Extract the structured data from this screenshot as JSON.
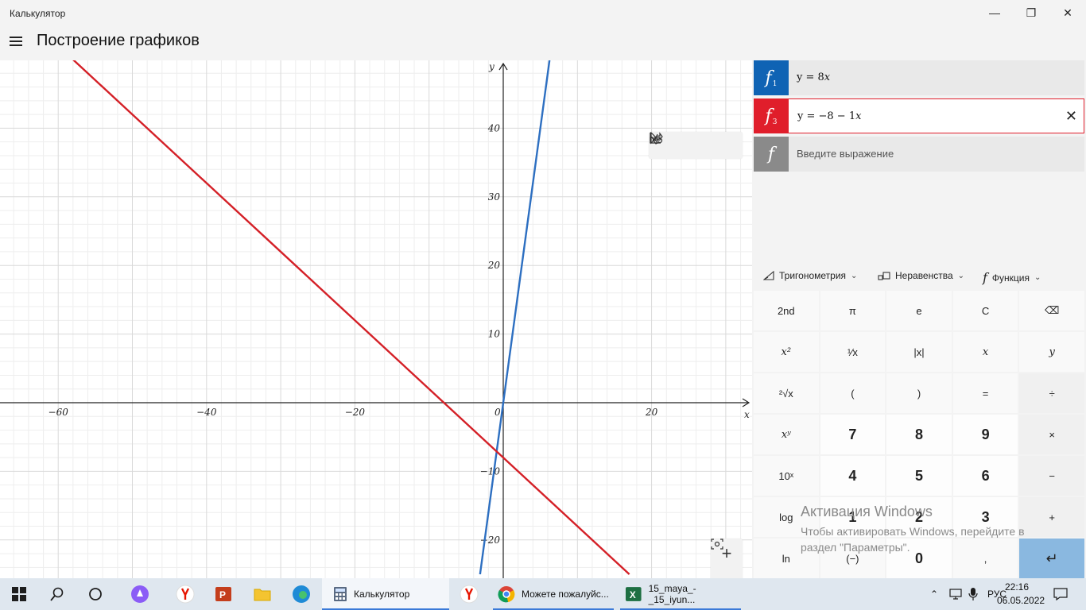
{
  "window": {
    "title": "Калькулятор"
  },
  "header": {
    "title": "Построение графиков"
  },
  "graph": {
    "x_ticks": [
      "−60",
      "−40",
      "−20",
      "0",
      "20"
    ],
    "y_ticks": [
      "40",
      "30",
      "20",
      "10",
      "−10",
      "−20"
    ],
    "x_axis_label": "x",
    "y_axis_label": "y",
    "colors": {
      "f1": "#2d6fc1",
      "f3": "#d42027",
      "grid": "#d9d9d9",
      "axis": "#222222"
    }
  },
  "chart_data": {
    "type": "line",
    "title": "",
    "xlabel": "x",
    "ylabel": "y",
    "xlim": [
      -68,
      33
    ],
    "ylim": [
      -25,
      50
    ],
    "grid": true,
    "series": [
      {
        "name": "y = 8x",
        "x": [
          -3.125,
          6.25
        ],
        "y": [
          -25,
          50
        ],
        "color": "#2d6fc1"
      },
      {
        "name": "y = −8 − 1x",
        "x": [
          -58,
          17
        ],
        "y": [
          50,
          -25
        ],
        "color": "#d42027"
      }
    ]
  },
  "functions": [
    {
      "badge": "f",
      "sub": "1",
      "prefix": "y = 8",
      "var": "x",
      "color": "#0f63b4"
    },
    {
      "badge": "f",
      "sub": "3",
      "prefix": "y = −8 − 1",
      "var": "x",
      "color": "#e01e2b"
    }
  ],
  "new_function": {
    "badge": "f",
    "placeholder": "Введите выражение",
    "color": "#8a8a8a"
  },
  "menus": {
    "trig": "Тригонометрия",
    "ineq": "Неравенства",
    "func": "Функция"
  },
  "keys": [
    [
      "2nd",
      "π",
      "e",
      "C",
      "⌫"
    ],
    [
      "x²",
      "¹⁄x",
      "|x|",
      "x",
      "y"
    ],
    [
      "²√x",
      "(",
      ")",
      "=",
      "÷"
    ],
    [
      "xʸ",
      "7",
      "8",
      "9",
      "×"
    ],
    [
      "10ˣ",
      "4",
      "5",
      "6",
      "−"
    ],
    [
      "log",
      "1",
      "2",
      "3",
      "+"
    ],
    [
      "ln",
      "(−)",
      "0",
      ",",
      "↵"
    ]
  ],
  "watermark": {
    "title": "Активация Windows",
    "text": "Чтобы активировать Windows, перейдите в раздел \"Параметры\"."
  },
  "taskbar": {
    "apps": [
      {
        "label": "Калькулятор"
      },
      {
        "label": "Можете пожалуйс..."
      },
      {
        "label": "15_maya_-_15_iyun..."
      }
    ],
    "lang": "РУС",
    "time": "22:16",
    "date": "06.05.2022"
  }
}
